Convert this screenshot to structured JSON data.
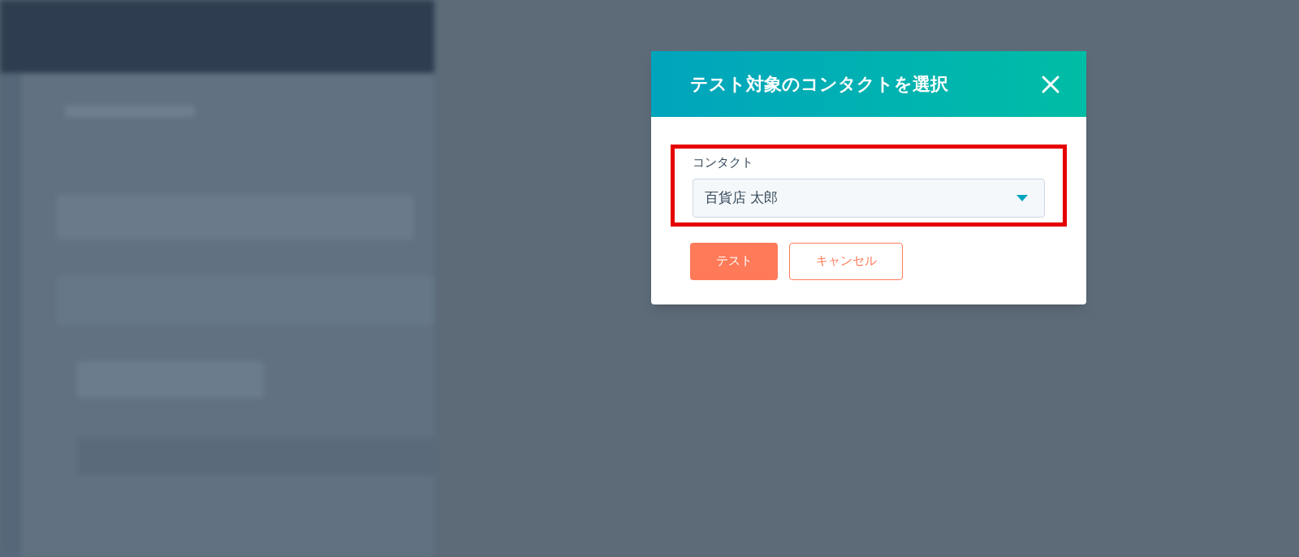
{
  "dialog": {
    "title": "テスト対象のコンタクトを選択",
    "field": {
      "label": "コンタクト",
      "value": "百貨店 太郎",
      "highlighted": true
    },
    "buttons": [
      {
        "label": "テスト",
        "kind": "primary"
      },
      {
        "label": "キャンセル",
        "kind": "secondary"
      }
    ]
  }
}
